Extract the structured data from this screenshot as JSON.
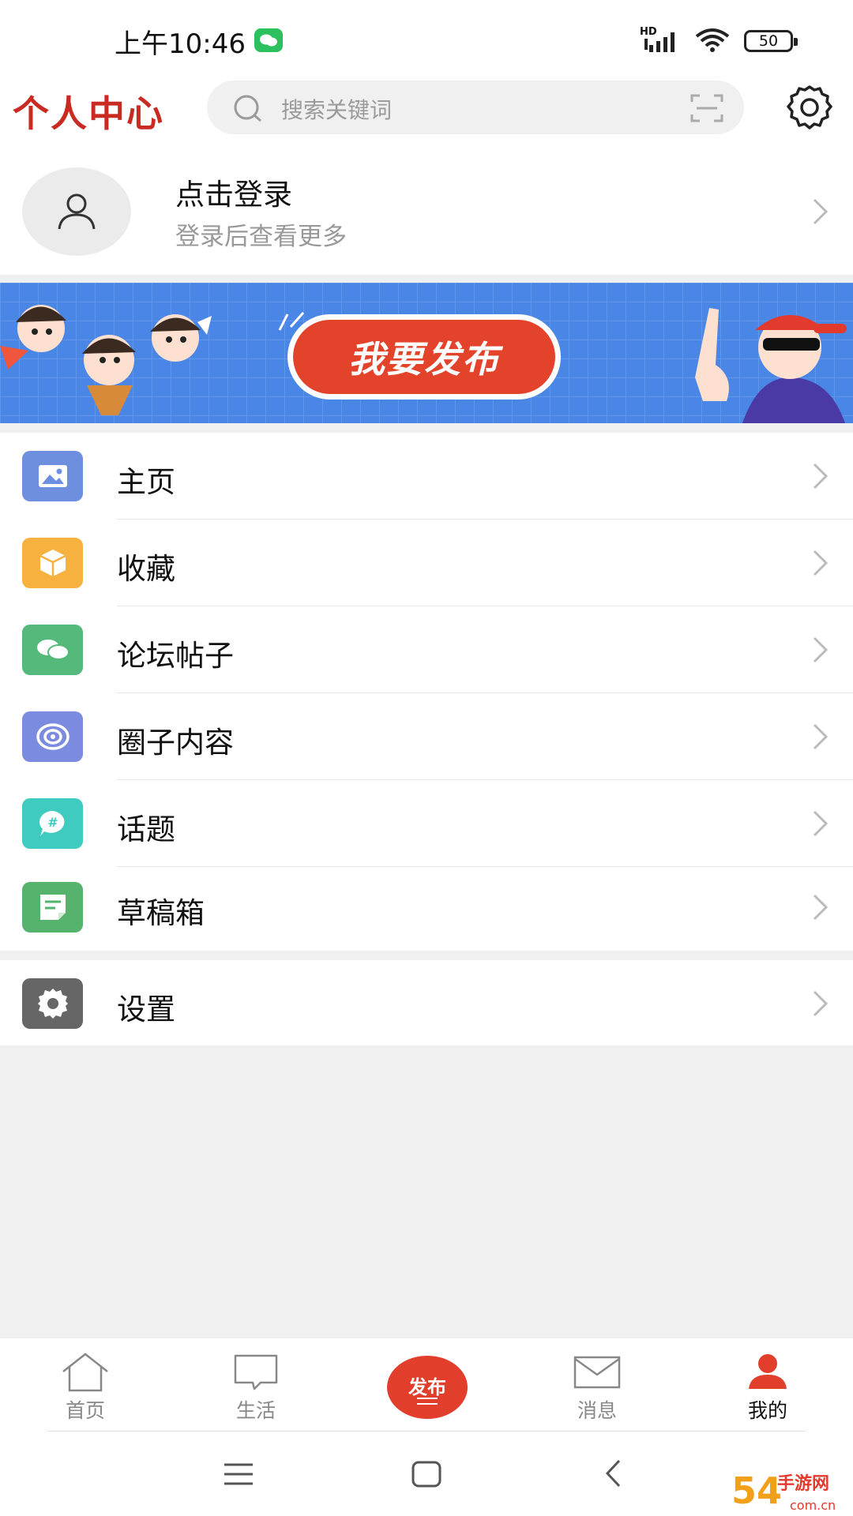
{
  "status_bar": {
    "time": "上午10:46",
    "network": "HD",
    "battery": "50"
  },
  "header": {
    "title": "个人中心",
    "search_placeholder": "搜索关键词"
  },
  "profile": {
    "title": "点击登录",
    "subtitle": "登录后查看更多"
  },
  "banner": {
    "button_label": "我要发布"
  },
  "menu": {
    "items": [
      {
        "label": "主页",
        "icon": "image-icon",
        "color": "#6e8ee0"
      },
      {
        "label": "收藏",
        "icon": "box-icon",
        "color": "#f6b13e"
      },
      {
        "label": "论坛帖子",
        "icon": "chat-bubbles-icon",
        "color": "#54b97a"
      },
      {
        "label": "圈子内容",
        "icon": "circle-swirl-icon",
        "color": "#7b8ce0"
      },
      {
        "label": "话题",
        "icon": "hashtag-bubble-icon",
        "color": "#3fcbbf"
      },
      {
        "label": "草稿箱",
        "icon": "note-icon",
        "color": "#56b36d"
      }
    ],
    "settings_label": "设置"
  },
  "bottom_nav": {
    "items": [
      {
        "label": "首页",
        "icon": "home-icon"
      },
      {
        "label": "生活",
        "icon": "chat-icon"
      },
      {
        "label": "发布",
        "icon": "publish-icon"
      },
      {
        "label": "消息",
        "icon": "mail-icon"
      },
      {
        "label": "我的",
        "icon": "user-icon",
        "active": true
      }
    ],
    "active_color": "#e13e2c"
  },
  "watermark": "54手游网 com.cn"
}
